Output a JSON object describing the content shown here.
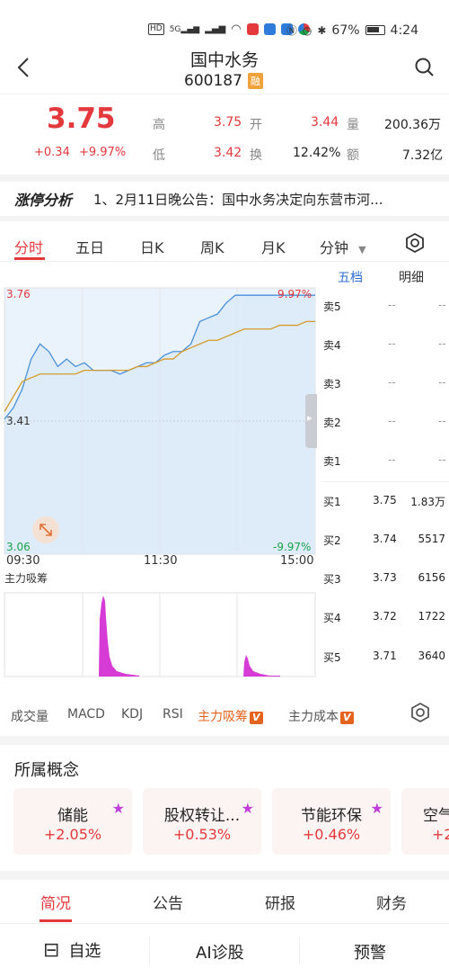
{
  "status_bar": {
    "left_icons": [
      "hd-icon",
      "signal-5g-icon",
      "signal-icon",
      "wifi-icon",
      "app-icon",
      "app-icon",
      "app-icon",
      "app-icon"
    ],
    "hd": "HD",
    "net": "5G",
    "battery": "67%",
    "time": "4:24"
  },
  "header": {
    "stock_name": "国中水务",
    "stock_code": "600187",
    "margin_badge": "融"
  },
  "quote": {
    "price": "3.75",
    "change": "+0.34",
    "change_pct": "+9.97%",
    "high_label": "高",
    "high": "3.75",
    "open_label": "开",
    "open": "3.44",
    "volume_label": "量",
    "volume": "200.36万",
    "low_label": "低",
    "low": "3.42",
    "turnover_label": "换",
    "turnover": "12.42%",
    "amount_label": "额",
    "amount": "7.32亿"
  },
  "news": {
    "logo": "涨停分析",
    "text": "1、2月11日晚公告：国中水务决定向东营市河..."
  },
  "chart_tabs": [
    "分时",
    "五日",
    "日K",
    "周K",
    "月K",
    "分钟"
  ],
  "chart_labels": {
    "y_top": "3.76",
    "y_mid": "3.41",
    "y_bottom": "3.06",
    "pct_top": "9.97%",
    "pct_bottom": "-9.97%",
    "t_start": "09:30",
    "t_mid": "11:30",
    "t_end": "15:00",
    "sub_title": "主力吸筹"
  },
  "chart_data": {
    "type": "line",
    "ylim": [
      3.06,
      3.76
    ],
    "x_ticks": [
      "09:30",
      "11:30",
      "15:00"
    ],
    "series": [
      {
        "values": [
          3.42,
          3.45,
          3.5,
          3.58,
          3.62,
          3.6,
          3.56,
          3.58,
          3.56,
          3.57,
          3.55,
          3.55,
          3.55,
          3.54,
          3.55,
          3.56,
          3.57,
          3.57,
          3.59,
          3.6,
          3.6,
          3.62,
          3.68,
          3.69,
          3.7,
          3.73,
          3.75,
          3.75,
          3.75,
          3.75,
          3.75,
          3.75,
          3.75,
          3.75,
          3.75,
          3.75
        ]
      },
      {
        "values": [
          3.44,
          3.48,
          3.52,
          3.53,
          3.54,
          3.54,
          3.54,
          3.54,
          3.54,
          3.55,
          3.55,
          3.55,
          3.55,
          3.55,
          3.55,
          3.56,
          3.56,
          3.57,
          3.58,
          3.58,
          3.6,
          3.61,
          3.62,
          3.63,
          3.63,
          3.64,
          3.65,
          3.66,
          3.66,
          3.66,
          3.66,
          3.67,
          3.67,
          3.67,
          3.68,
          3.68
        ]
      }
    ]
  },
  "order_book": {
    "tabs": [
      "五档",
      "明细"
    ],
    "asks": [
      {
        "label": "卖5",
        "price": "--",
        "vol": "--"
      },
      {
        "label": "卖4",
        "price": "--",
        "vol": "--"
      },
      {
        "label": "卖3",
        "price": "--",
        "vol": "--"
      },
      {
        "label": "卖2",
        "price": "--",
        "vol": "--"
      },
      {
        "label": "卖1",
        "price": "--",
        "vol": "--"
      }
    ],
    "bids": [
      {
        "label": "买1",
        "price": "3.75",
        "vol": "1.83万"
      },
      {
        "label": "买2",
        "price": "3.74",
        "vol": "5517"
      },
      {
        "label": "买3",
        "price": "3.73",
        "vol": "6156"
      },
      {
        "label": "买4",
        "price": "3.72",
        "vol": "1722"
      },
      {
        "label": "买5",
        "price": "3.71",
        "vol": "3640"
      }
    ]
  },
  "indicators": [
    "成交量",
    "MACD",
    "KDJ",
    "RSI",
    "主力吸筹",
    "主力成本"
  ],
  "indicator_badge": "V",
  "concepts": {
    "title": "所属概念",
    "items": [
      {
        "name": "储能",
        "change": "+2.05%"
      },
      {
        "name": "股权转让...",
        "change": "+0.53%"
      },
      {
        "name": "节能环保",
        "change": "+0.46%"
      },
      {
        "name": "空气",
        "change": "+2"
      }
    ]
  },
  "bottom_tabs": [
    "简况",
    "公告",
    "研报",
    "财务"
  ],
  "actions": {
    "watch_icon": "⊟",
    "watch": "自选",
    "ai": "AI诊股",
    "alert": "预警"
  },
  "colors": {
    "up": "#e4393c",
    "down": "#1aa34a",
    "accent": "#e4393c",
    "line": "#4a90d9",
    "avg": "#d49a2a",
    "volume": "#d63bd6"
  }
}
